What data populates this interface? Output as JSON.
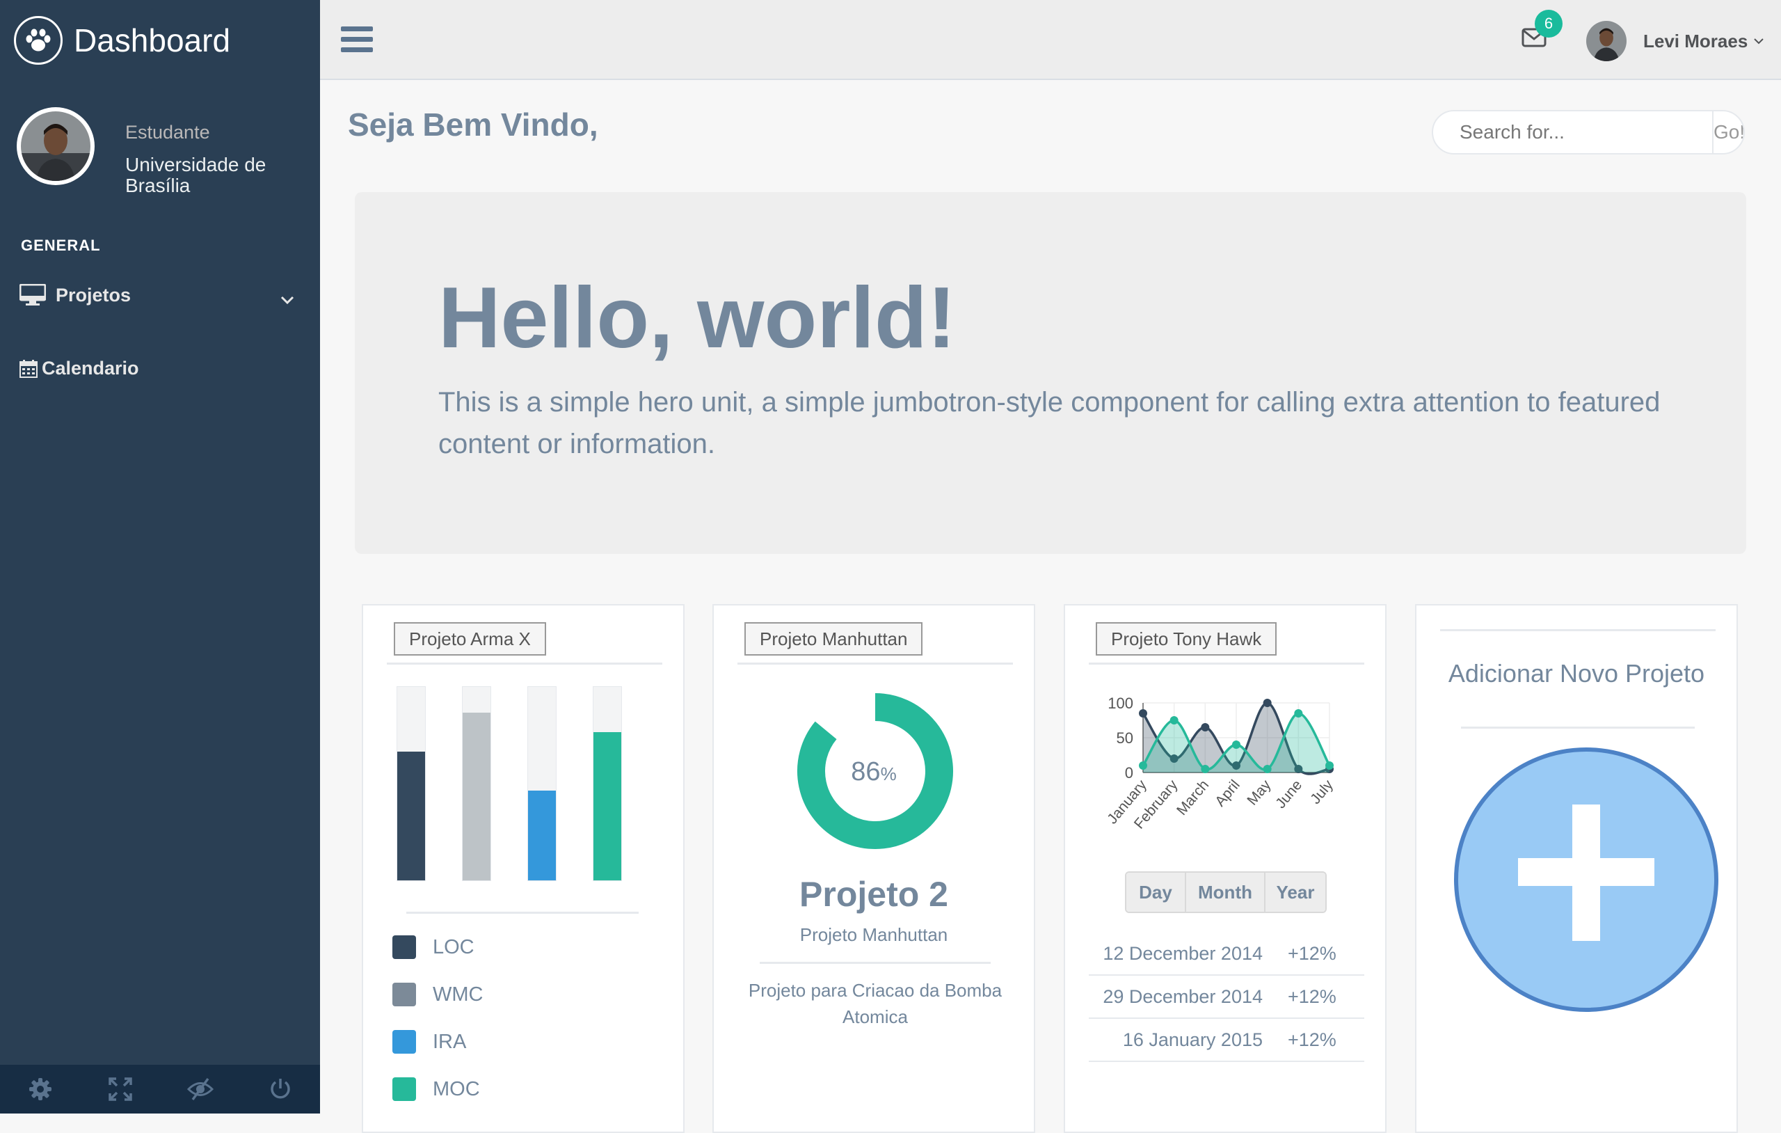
{
  "brand": {
    "title": "Dashboard"
  },
  "profile": {
    "role": "Estudante",
    "institution": "Universidade de Brasília"
  },
  "sidebar": {
    "section_label": "GENERAL",
    "items": [
      {
        "label": "Projetos",
        "icon": "monitor-icon"
      },
      {
        "label": "Calendario",
        "icon": "calendar-icon"
      }
    ],
    "footer_icons": [
      "gear-icon",
      "fullscreen-icon",
      "eye-slash-icon",
      "power-icon"
    ]
  },
  "topbar": {
    "mail_badge": "6",
    "user_name": "Levi Moraes"
  },
  "main": {
    "title": "Seja Bem Vindo,",
    "search": {
      "placeholder": "Search for...",
      "button": "Go!"
    },
    "jumbotron": {
      "title": "Hello, world!",
      "text": "This is a simple hero unit, a simple jumbotron-style component for calling extra attention to featured content or information."
    }
  },
  "cards": {
    "arma": {
      "tag": "Projeto Arma X",
      "bars": [
        {
          "name": "LOC",
          "value": 0.66,
          "color": "#34495E"
        },
        {
          "name": "WMC",
          "value": 0.86,
          "color": "#BDC3C7"
        },
        {
          "name": "IRA",
          "value": 0.46,
          "color": "#3498DB"
        },
        {
          "name": "MOC",
          "value": 0.76,
          "color": "#26B99A"
        }
      ]
    },
    "manhuttan": {
      "tag": "Projeto Manhuttan",
      "percent": 86,
      "percent_value": "86",
      "percent_unit": "%",
      "title": "Projeto 2",
      "subtitle": "Projeto Manhuttan",
      "description": "Projeto para Criacao da Bomba Atomica",
      "color": "#26B99A"
    },
    "tonyhawk": {
      "tag": "Projeto Tony Hawk",
      "range_buttons": [
        "Day",
        "Month",
        "Year"
      ],
      "rows": [
        {
          "date": "12 December 2014",
          "change": "+12%"
        },
        {
          "date": "29 December 2014",
          "change": "+12%"
        },
        {
          "date": "16 January 2015",
          "change": "+12%"
        }
      ]
    },
    "add": {
      "title": "Adicionar Novo Projeto"
    }
  },
  "chart_data": {
    "type": "area",
    "categories": [
      "January",
      "February",
      "March",
      "April",
      "May",
      "June",
      "July"
    ],
    "series": [
      {
        "values": [
          85,
          20,
          65,
          10,
          100,
          5,
          5
        ],
        "color": "#34495E"
      },
      {
        "values": [
          10,
          75,
          5,
          40,
          5,
          85,
          10
        ],
        "color": "#26B99A"
      }
    ],
    "yticks": [
      "100",
      "50",
      "0"
    ],
    "ylim": [
      0,
      100
    ],
    "grid": true
  }
}
